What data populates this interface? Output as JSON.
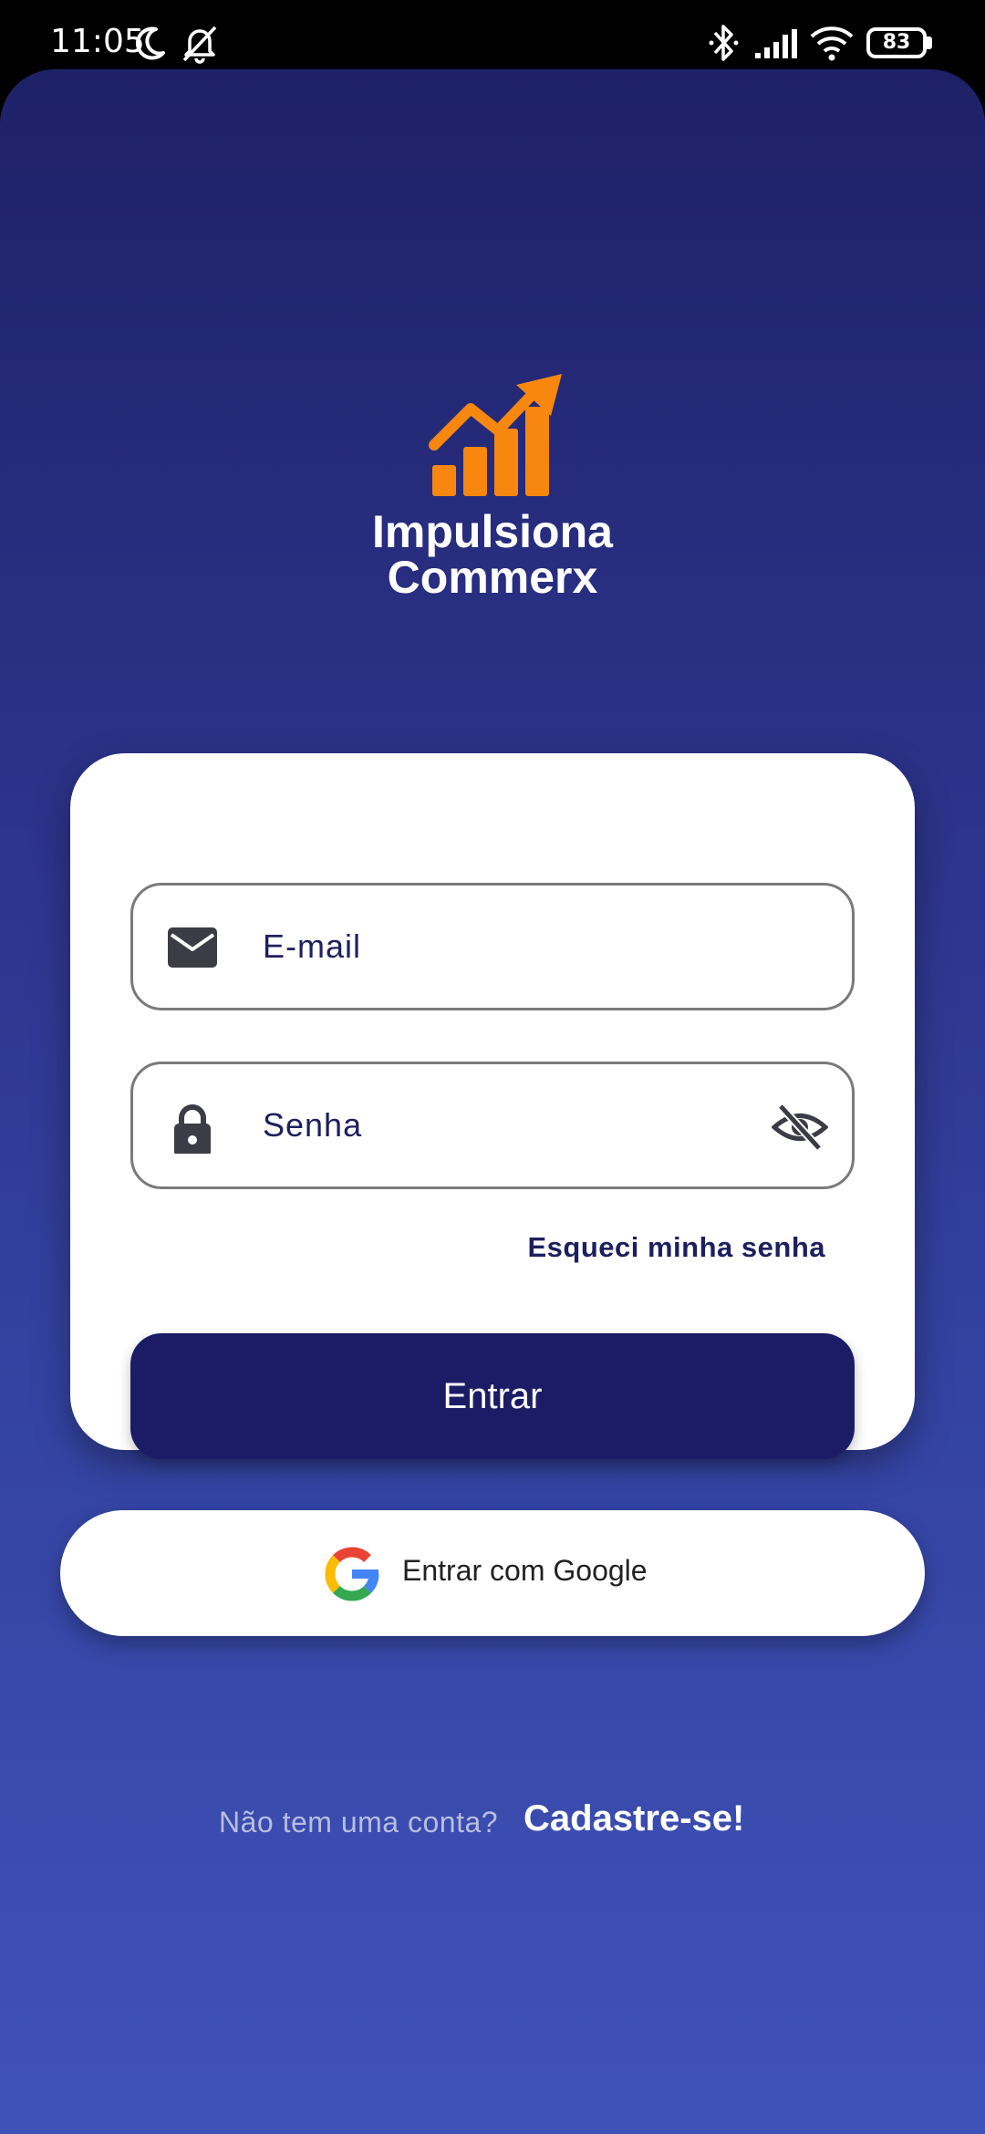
{
  "status_bar": {
    "time": "11:05",
    "battery": "83"
  },
  "logo": {
    "line1": "Impulsiona",
    "line2": "Commerx",
    "accent_color": "#f7870f"
  },
  "login_form": {
    "email_placeholder": "E-mail",
    "password_placeholder": "Senha",
    "forgot_password": "Esqueci minha senha",
    "submit_label": "Entrar"
  },
  "google_login": {
    "label": "Entrar com Google"
  },
  "signup": {
    "prompt": "Não tem uma conta?",
    "link": "Cadastre-se!"
  },
  "colors": {
    "primary_dark": "#1c1c66",
    "background_top": "#1e2166",
    "background_bottom": "#3f52b8"
  },
  "icons": {
    "email": "envelope-icon",
    "password": "lock-icon",
    "visibility": "eye-off-icon",
    "google": "google-icon"
  }
}
